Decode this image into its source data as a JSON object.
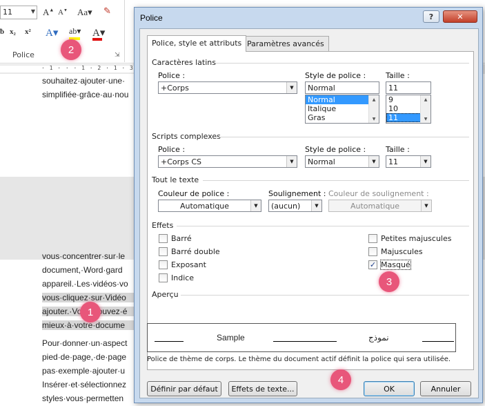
{
  "ribbon": {
    "font_size": "11",
    "group_label": "Police"
  },
  "ruler": {
    "ticks": "· 1 · ·   · 1 · 2 · 1 · 3 ·"
  },
  "document": {
    "lines_top": [
      "souhaitez·ajouter·une·",
      "simplifiée·grâce·au·nou"
    ],
    "lines_bottom": [
      "vous·concentrer·sur·le",
      "document,·Word·gard",
      "appareil.·Les·vidéos·vo",
      "vous·cliquez·sur·Vidéo",
      "ajouter.·Vous·pouvez·é",
      "mieux·à·votre·docume",
      "Pour·donner·un·aspect",
      "pied·de·page,·de·page",
      "pas·exemple·ajouter·u",
      "Insérer·et·sélectionnez",
      "styles·vous·permetten"
    ]
  },
  "badges": [
    "1",
    "2",
    "3",
    "4"
  ],
  "dialog": {
    "title": "Police",
    "help_label": "?",
    "close_label": "✕",
    "tabs": [
      "Police, style et attributs",
      "Paramètres avancés"
    ],
    "latin": {
      "section": "Caractères latins",
      "font_label": "Police :",
      "font_value": "+Corps",
      "style_label": "Style de police :",
      "style_value": "Normal",
      "style_options": [
        "Normal",
        "Italique",
        "Gras"
      ],
      "size_label": "Taille :",
      "size_value": "11",
      "size_options": [
        "9",
        "10",
        "11"
      ]
    },
    "complex": {
      "section": "Scripts complexes",
      "font_label": "Police :",
      "font_value": "+Corps CS",
      "style_label": "Style de police :",
      "style_value": "Normal",
      "size_label": "Taille :",
      "size_value": "11"
    },
    "all_text": {
      "section": "Tout le texte",
      "color_label": "Couleur de police :",
      "color_value": "Automatique",
      "underline_label": "Soulignement :",
      "underline_value": "(aucun)",
      "underline_color_label": "Couleur de soulignement :",
      "underline_color_value": "Automatique"
    },
    "effects": {
      "section": "Effets",
      "left": [
        {
          "label": "Barré",
          "checked": false
        },
        {
          "label": "Barré double",
          "checked": false
        },
        {
          "label": "Exposant",
          "checked": false
        },
        {
          "label": "Indice",
          "checked": false
        }
      ],
      "right": [
        {
          "label": "Petites majuscules",
          "checked": false
        },
        {
          "label": "Majuscules",
          "checked": false
        },
        {
          "label": "Masqué",
          "checked": true
        }
      ]
    },
    "preview": {
      "section": "Aperçu",
      "sample": "Sample",
      "sample_arabic": "نموذج",
      "note": "Police de thème de corps. Le thème du document actif définit la police qui sera utilisée."
    },
    "buttons": {
      "default": "Définir par défaut",
      "text_effects": "Effets de texte...",
      "ok": "OK",
      "cancel": "Annuler"
    }
  },
  "colors": {
    "badge": "#e8567a",
    "dialog_frame": "#c7d9ee",
    "selection": "#3399ff"
  }
}
